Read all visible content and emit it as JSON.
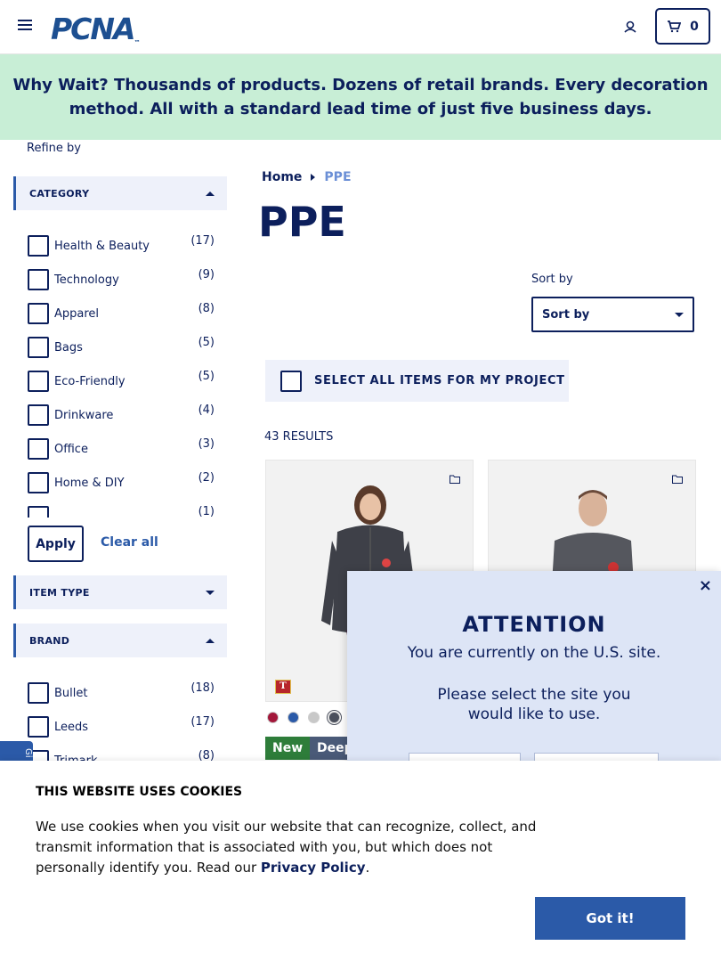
{
  "header": {
    "logo_text": "PCNA",
    "logo_mark": "™",
    "cart_count": "0"
  },
  "banner": {
    "text": "Why Wait? Thousands of products. Dozens of retail brands. Every decoration method. All with a standard lead time of just five business days."
  },
  "sidebar": {
    "refine_label": "Refine by",
    "category": {
      "title": "CATEGORY",
      "items": [
        {
          "label": "Health & Beauty",
          "count": "(17)"
        },
        {
          "label": "Technology",
          "count": "(9)"
        },
        {
          "label": "Apparel",
          "count": "(8)"
        },
        {
          "label": "Bags",
          "count": "(5)"
        },
        {
          "label": "Eco-Friendly",
          "count": "(5)"
        },
        {
          "label": "Drinkware",
          "count": "(4)"
        },
        {
          "label": "Office",
          "count": "(3)"
        },
        {
          "label": "Home & DIY",
          "count": "(2)"
        },
        {
          "label": "",
          "count": "(1)"
        }
      ]
    },
    "apply_label": "Apply",
    "clear_label": "Clear all",
    "item_type_title": "ITEM TYPE",
    "brand": {
      "title": "BRAND",
      "items": [
        {
          "label": "Bullet",
          "count": "(18)"
        },
        {
          "label": "Leeds",
          "count": "(17)"
        },
        {
          "label": "Trimark",
          "count": "(8)"
        }
      ]
    },
    "side_tab_text": "Gi"
  },
  "main": {
    "breadcrumb_home": "Home",
    "breadcrumb_current": "PPE",
    "title": "PPE",
    "sort_label": "Sort by",
    "sort_value": "Sort by",
    "select_all_label": "SELECT ALL ITEMS FOR MY PROJECT",
    "results": "43 RESULTS",
    "card1_badge": "T",
    "swatch_colors": [
      "#a3173a",
      "#2b5aa8",
      "#c8c8c8",
      "#4a4f5c"
    ],
    "tag_new": "New",
    "tag_deep": "Deep"
  },
  "modal": {
    "close": "×",
    "title": "ATTENTION",
    "line1": "You are currently on the U.S. site.",
    "line2": "Please select the site you would like to use."
  },
  "cookie": {
    "title": "THIS WEBSITE USES COOKIES",
    "text_before": "We use cookies when you visit our website that can recognize, collect, and transmit information that is associated with you, but which does not personally identify you. Read our ",
    "link": "Privacy Policy",
    "text_after": ".",
    "button": "Got it!"
  },
  "colors": {
    "navy": "#0c1f5c",
    "accent_blue": "#2b5aa8",
    "banner_green": "#c8eed6",
    "modal_bg": "#dde5f6"
  }
}
